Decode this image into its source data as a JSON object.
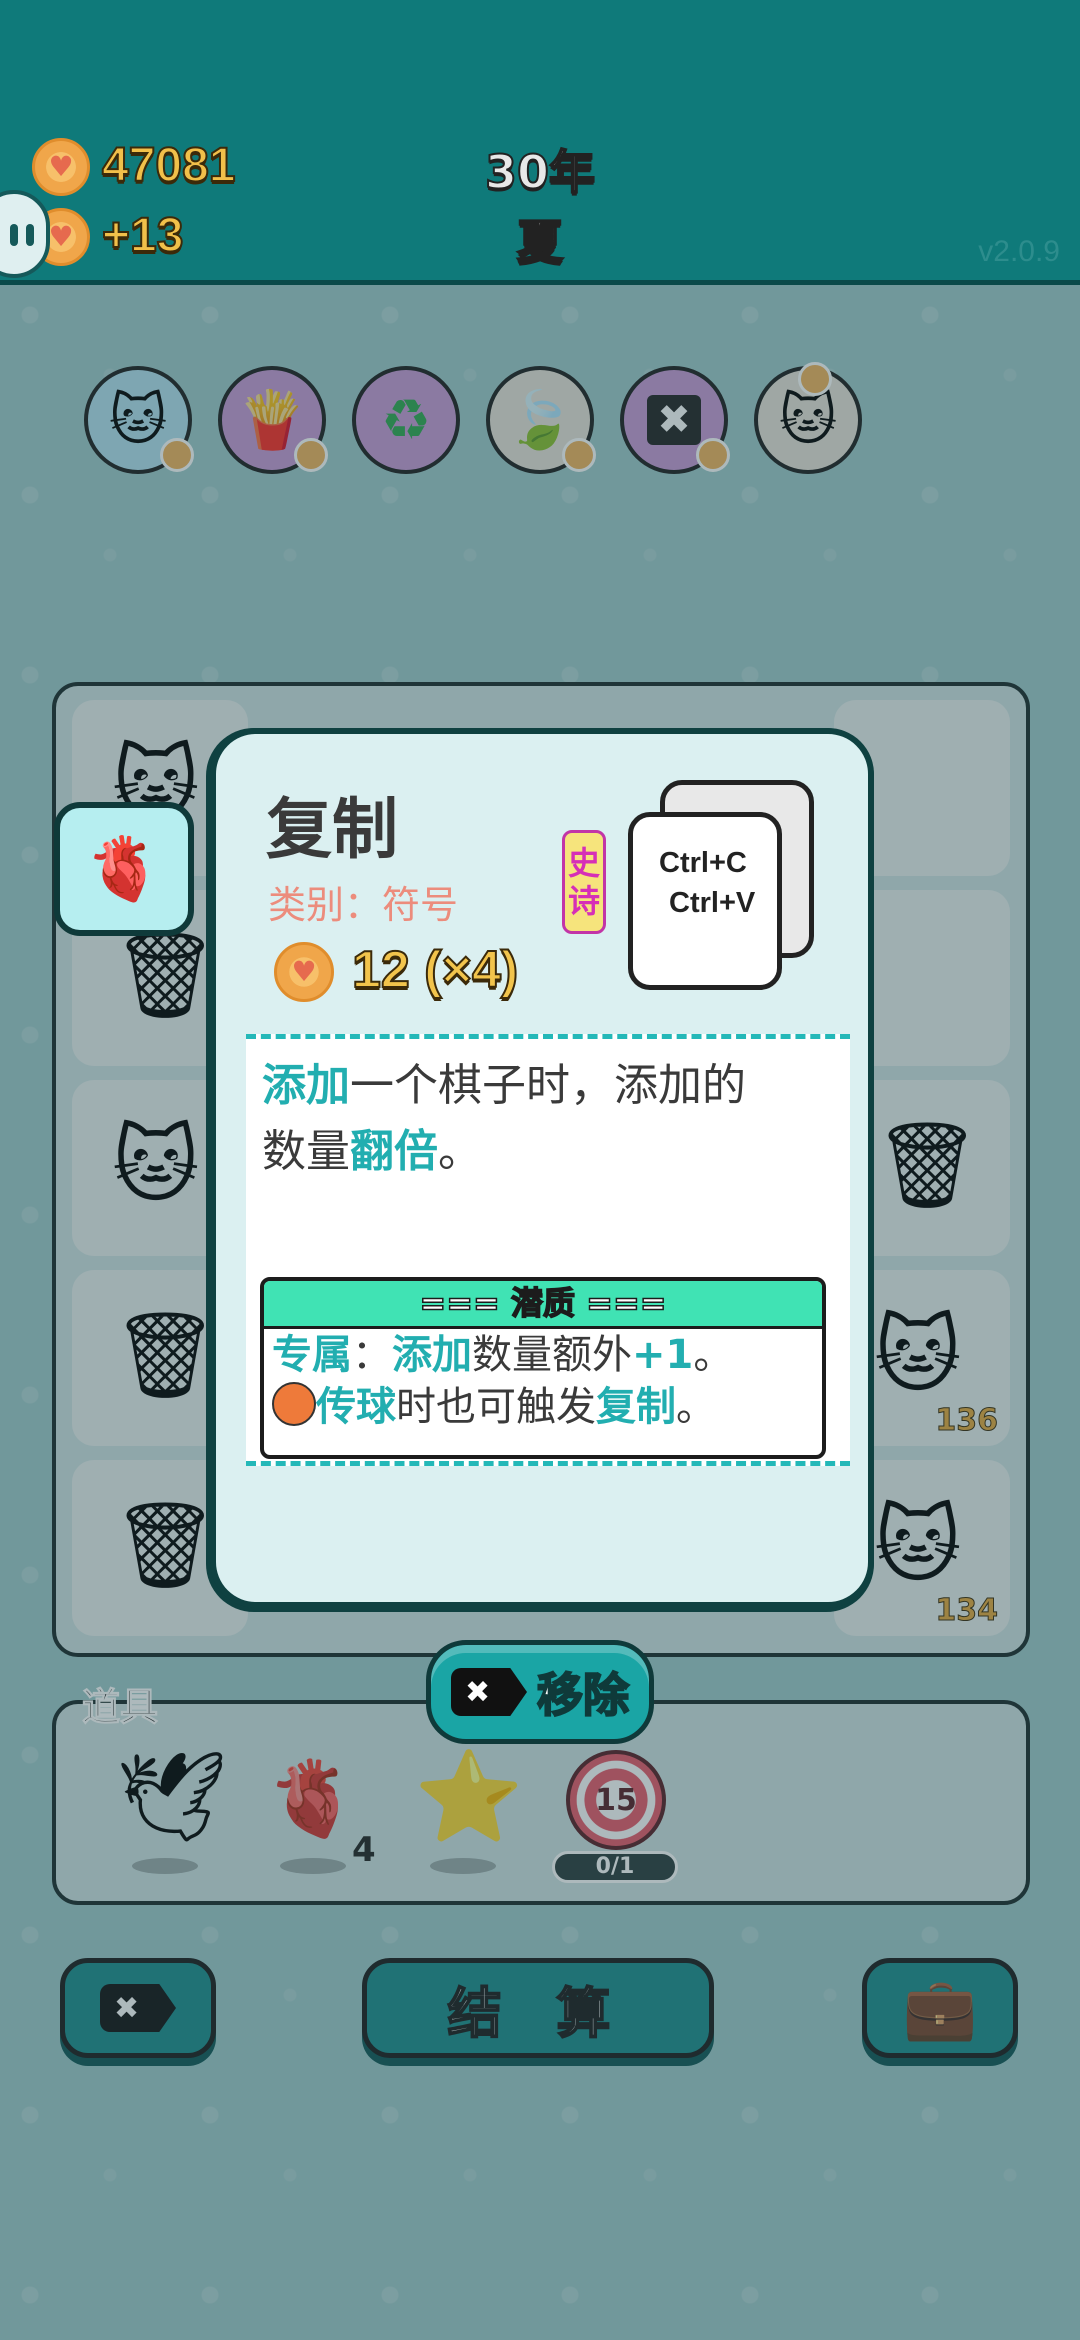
{
  "header": {
    "coins": "47081",
    "income": "+13",
    "year": "30年",
    "season": "夏",
    "version": "v2.0.9"
  },
  "relics": [
    {
      "name": "cat-with-coin",
      "bg": "#b3e0ef"
    },
    {
      "name": "french-fries",
      "bg": "#c99ad6"
    },
    {
      "name": "recycle",
      "bg": "#c99ad6"
    },
    {
      "name": "leaf",
      "bg": "#e8e3d8"
    },
    {
      "name": "delete-key",
      "bg": "#c99ad6"
    },
    {
      "name": "twin-cats",
      "bg": "#e8e3d8"
    }
  ],
  "board": {
    "visible_counts": [
      "136",
      "134"
    ]
  },
  "items": {
    "label": "道具",
    "liver_count": "4",
    "target_value": "15",
    "target_progress": "0/1"
  },
  "card": {
    "title": "复制",
    "category": "类别：符号",
    "rarity": [
      "史",
      "诗"
    ],
    "key_line_1": "Ctrl+C",
    "key_line_2": "Ctrl+V",
    "price": "12 (×4)",
    "desc": {
      "p1_hl": "添加",
      "p1_a": "一个棋子时，添加的",
      "p1_b": "数量",
      "p1_hl2": "翻倍",
      "p1_end": "。"
    },
    "potential": {
      "title": "=== 潜质 ===",
      "l1_hl": "专属",
      "l1_a": "：",
      "l1_hl2": "添加",
      "l1_b": "数量额外",
      "l1_hl3": "+1",
      "l1_end": "。",
      "l2_hl": "传球",
      "l2_a": "时也可触发",
      "l2_hl2": "复制",
      "l2_end": "。"
    }
  },
  "buttons": {
    "remove": "移除",
    "settle": "结 算"
  },
  "colors": {
    "header": "#0f7a7a",
    "accent": "#22aeb0",
    "rarity": "#d62fb7"
  }
}
